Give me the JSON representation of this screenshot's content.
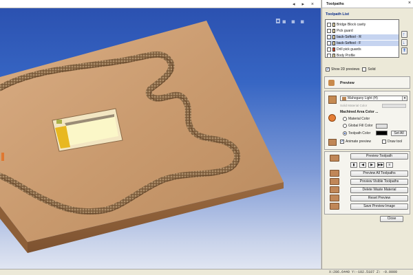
{
  "viewport": {
    "logo_text": "◘▪ ▪ ▪",
    "controls": "◂ ▸ ×"
  },
  "panel": {
    "title": "Toolpaths",
    "close_glyph": "×",
    "toolpath_list": {
      "header": "Toolpath List",
      "items": [
        {
          "label": "Bridge Block cavity",
          "selected": false
        },
        {
          "label": "Pick guard",
          "selected": false
        },
        {
          "label": "back-Softool - R",
          "selected": true
        },
        {
          "label": "back-Softool - F",
          "selected": true
        },
        {
          "label": "Drill pick guards",
          "selected": false
        },
        {
          "label": "Body Profile",
          "selected": false
        }
      ]
    },
    "show_2d_previews": {
      "label": "Show 2D previews",
      "checked": true
    },
    "solid": {
      "label": "Solid",
      "checked": false
    },
    "preview": {
      "header": "Preview",
      "material_select": "Mahogany Light (H)",
      "solid_material_color": "Solid Material Color",
      "machined_area_color": "Machined Area Color ...",
      "radios": [
        {
          "label": "Material Color",
          "on": false
        },
        {
          "label": "Global Fill Color",
          "on": false
        },
        {
          "label": "Toolpath Color",
          "on": true
        }
      ],
      "set_all": "Set All",
      "animate_preview": {
        "label": "Animate preview",
        "checked": true
      },
      "draw_tool": {
        "label": "Draw tool",
        "checked": false
      }
    },
    "actions": {
      "preview_toolpath": "Preview Toolpath",
      "transport": [
        "▮",
        "◀",
        "▶",
        "▶▶",
        "≡"
      ],
      "preview_all": "Preview All Toolpaths",
      "preview_visible": "Preview Visible Toolpaths",
      "delete_waste": "Delete Waste Material",
      "reset_preview": "Reset Preview",
      "save_preview_image": "Save Preview Image"
    },
    "close": "Close"
  },
  "status": {
    "text": "X:286.6440 Y:-102.5187 Z: -0.0000"
  },
  "colors": {
    "wood": "#c9976a",
    "sky_top": "#2a4fae",
    "toolpath_color": "#000000",
    "accent": "#0b2e8a"
  }
}
